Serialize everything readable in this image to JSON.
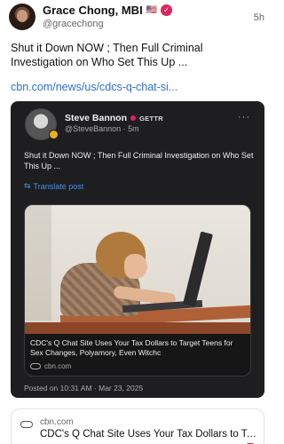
{
  "post": {
    "author_name": "Grace Chong, MBI",
    "author_flag": "🇺🇸",
    "author_handle": "@gracechong",
    "time": "5h",
    "text": "Shut it Down NOW ; Then Full Criminal Investigation on Who Set This Up ...",
    "link": "cbn.com/news/us/cdcs-q-chat-si..."
  },
  "quoted": {
    "author_name": "Steve Bannon",
    "platform": "GETTR",
    "handle_time": "@SteveBannon · 5m",
    "text": "Shut it Down NOW ; Then  Full Criminal Investigation on Who Set This Up ...",
    "translate_label": "Translate post",
    "link_card": {
      "title": "CDC's Q Chat Site Uses Your Tax Dollars to Target Teens for Sex Changes, Polyamory, Even Witchc",
      "domain": "cbn.com"
    },
    "footer": "Posted on 10:31 AM · Mar 23, 2025"
  },
  "preview": {
    "domain": "cbn.com",
    "title": "CDC's Q Chat Site Uses Your Tax Dollars to Tar..."
  },
  "colors": {
    "accent_link": "#2f6fd6",
    "card_bg": "#1e1e20",
    "verified": "#e0245e"
  }
}
